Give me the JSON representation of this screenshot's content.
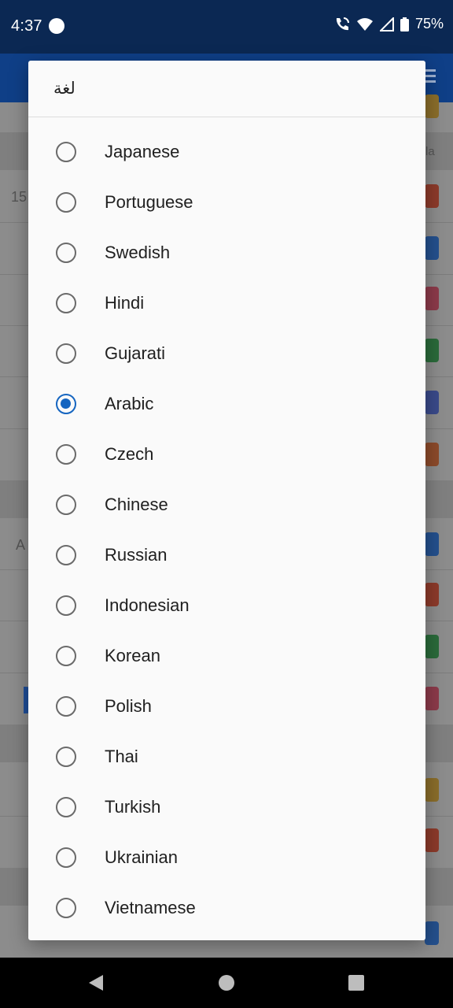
{
  "status_bar": {
    "time": "4:37",
    "battery": "75%"
  },
  "background_app": {
    "row_text_1": "15",
    "row_text_2": "A",
    "side_label": "la"
  },
  "dialog": {
    "title": "لغة",
    "selected": "Arabic",
    "options": [
      "Japanese",
      "Portuguese",
      "Swedish",
      "Hindi",
      "Gujarati",
      "Arabic",
      "Czech",
      "Chinese",
      "Russian",
      "Indonesian",
      "Korean",
      "Polish",
      "Thai",
      "Turkish",
      "Ukrainian",
      "Vietnamese"
    ]
  },
  "colors": {
    "accent": "#1565c0",
    "status_bar": "#0b2853",
    "app_bar": "#0f3f87"
  }
}
